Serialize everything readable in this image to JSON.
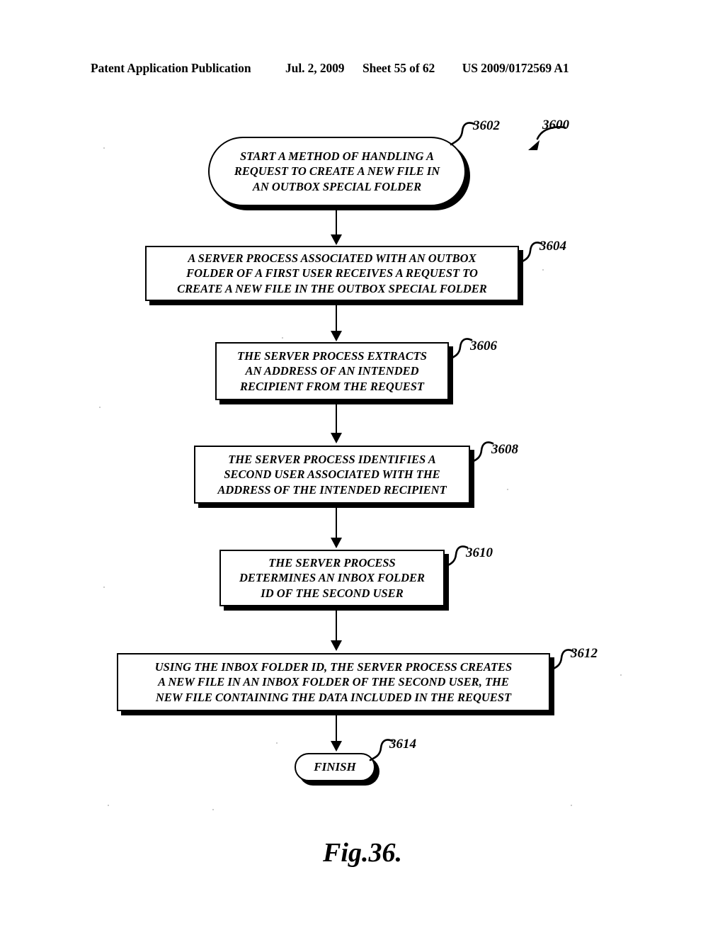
{
  "header": {
    "publication": "Patent Application Publication",
    "date": "Jul. 2, 2009",
    "sheet": "Sheet 55 of 62",
    "patent_number": "US 2009/0172569 A1"
  },
  "figure": {
    "caption": "Fig.36.",
    "diagram_ref": "3600"
  },
  "nodes": [
    {
      "id": "start",
      "ref": "3602",
      "shape": "stadium",
      "lines": [
        "START A METHOD OF HANDLING A",
        "REQUEST TO CREATE A NEW FILE IN",
        "AN OUTBOX SPECIAL FOLDER"
      ]
    },
    {
      "id": "step-3604",
      "ref": "3604",
      "shape": "rect",
      "lines": [
        "A SERVER PROCESS ASSOCIATED WITH AN OUTBOX",
        "FOLDER OF A FIRST USER RECEIVES A REQUEST TO",
        "CREATE A NEW FILE IN THE OUTBOX SPECIAL FOLDER"
      ]
    },
    {
      "id": "step-3606",
      "ref": "3606",
      "shape": "rect",
      "lines": [
        "THE SERVER PROCESS EXTRACTS",
        "AN ADDRESS OF AN INTENDED",
        "RECIPIENT FROM THE REQUEST"
      ]
    },
    {
      "id": "step-3608",
      "ref": "3608",
      "shape": "rect",
      "lines": [
        "THE SERVER PROCESS IDENTIFIES A",
        "SECOND USER ASSOCIATED WITH THE",
        "ADDRESS OF THE INTENDED RECIPIENT"
      ]
    },
    {
      "id": "step-3610",
      "ref": "3610",
      "shape": "rect",
      "lines": [
        "THE SERVER PROCESS",
        "DETERMINES AN INBOX FOLDER",
        "ID OF THE SECOND USER"
      ]
    },
    {
      "id": "step-3612",
      "ref": "3612",
      "shape": "rect",
      "lines": [
        "USING THE INBOX FOLDER ID, THE SERVER PROCESS CREATES",
        "A NEW FILE IN AN INBOX FOLDER OF THE SECOND USER, THE",
        "NEW FILE CONTAINING THE DATA INCLUDED IN THE REQUEST"
      ]
    },
    {
      "id": "finish",
      "ref": "3614",
      "shape": "stadium",
      "lines": [
        "FINISH"
      ]
    }
  ],
  "colors": {
    "ink": "#000000",
    "paper": "#ffffff"
  }
}
